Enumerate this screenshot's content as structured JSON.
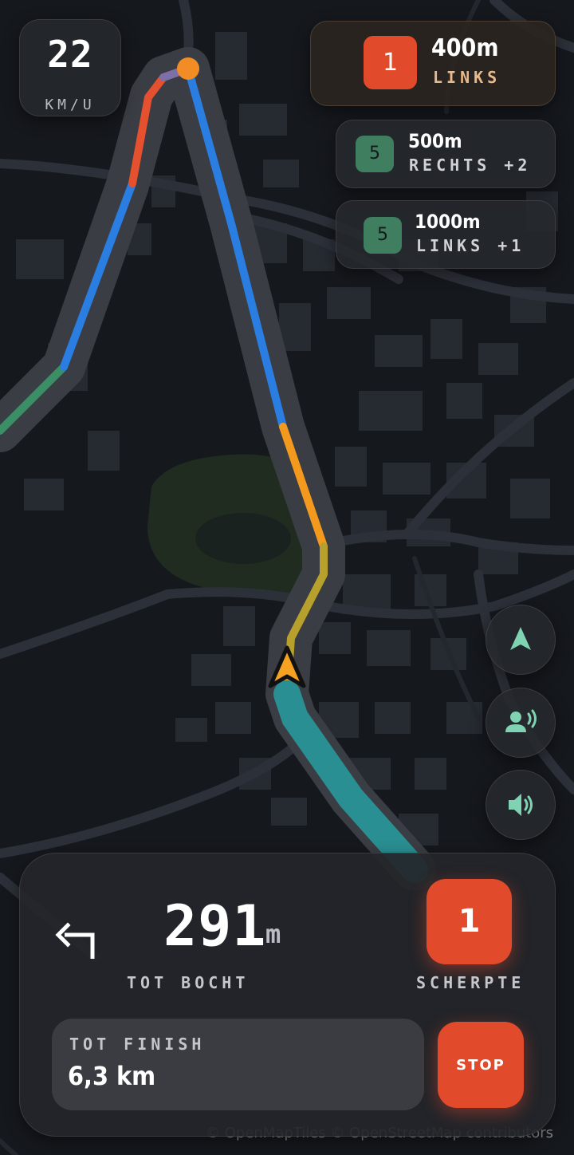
{
  "speed": {
    "value": "22",
    "unit": "KM/U"
  },
  "upcoming_turns": [
    {
      "severity": "1",
      "distance": "400m",
      "direction": "LINKS",
      "color": "#e24a2c"
    },
    {
      "severity": "5",
      "distance": "500m",
      "direction": "RECHTS +2",
      "color": "#3f7e5f"
    },
    {
      "severity": "5",
      "distance": "1000m",
      "direction": "LINKS +1",
      "color": "#3f7e5f"
    }
  ],
  "controls": [
    {
      "icon": "navigation-arrow-icon"
    },
    {
      "icon": "voice-icon"
    },
    {
      "icon": "speaker-icon"
    }
  ],
  "current_turn": {
    "direction_icon": "turn-left-icon",
    "distance": "291",
    "unit": "m",
    "distance_label": "TOT BOCHT",
    "severity": "1",
    "severity_label": "SCHERPTE"
  },
  "finish": {
    "label": "TOT FINISH",
    "value": "6,3 km"
  },
  "stop_button": {
    "label": "STOP"
  },
  "attribution": "© OpenMapTiles © OpenStreetMap contributors",
  "colors": {
    "accent_red": "#e24a2c",
    "badge_green": "#3f7e5f",
    "route_blue": "#2a7de1",
    "route_orange": "#f39a1e",
    "route_red": "#e5502f",
    "route_green": "#3a8f66",
    "route_teal": "#2a8f92",
    "icon_mint": "#7fd2b2"
  }
}
